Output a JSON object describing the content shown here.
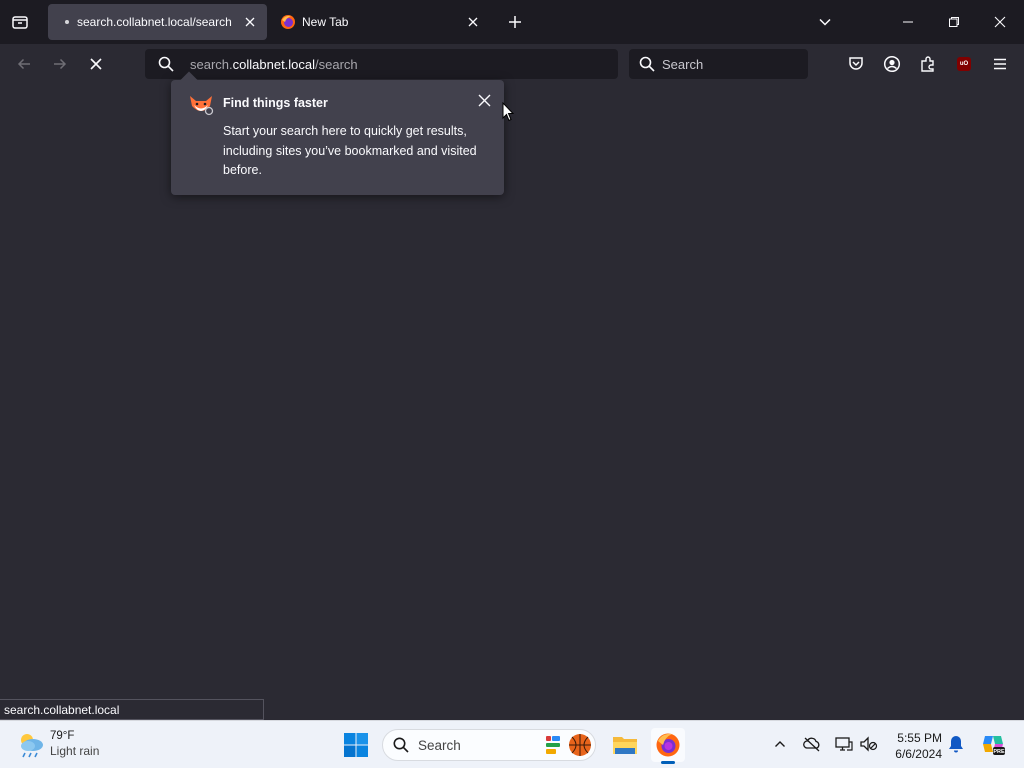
{
  "tabs": [
    {
      "title": "search.collabnet.local/search",
      "active": true
    },
    {
      "title": "New Tab",
      "active": false
    }
  ],
  "urlbar": {
    "prefix": "search.",
    "host": "collabnet.local",
    "path": "/search"
  },
  "searchbar": {
    "placeholder": "Search"
  },
  "popup": {
    "title": "Find things faster",
    "body": "Start your search here to quickly get results, including sites you’ve bookmarked and visited before."
  },
  "status": {
    "text": "search.collabnet.local"
  },
  "taskbar": {
    "weather": {
      "temp": "79°F",
      "condition": "Light rain"
    },
    "search_label": "Search",
    "time": "5:55 PM",
    "date": "6/6/2024"
  },
  "colors": {
    "accent": "#005fb8",
    "popup_bg": "#42414d",
    "toolbar_bg": "#2b2a33",
    "tabstrip_bg": "#1c1b22"
  }
}
